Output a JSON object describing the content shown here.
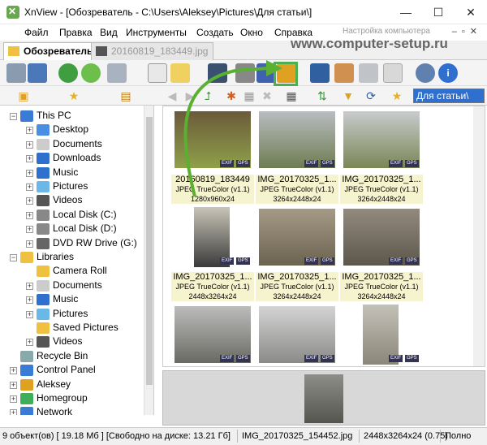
{
  "window": {
    "title": "XnView - [Обозреватель - C:\\Users\\Aleksey\\Pictures\\Для статьи\\]"
  },
  "menu": {
    "items": [
      "Файл",
      "Правка",
      "Вид",
      "Инструменты",
      "Создать",
      "Окно",
      "Справка"
    ]
  },
  "watermark": {
    "small": "Настройка компьютера",
    "site": "www.computer-setup.ru"
  },
  "tabs": [
    {
      "label": "Обозреватель",
      "active": true
    },
    {
      "label": "20160819_183449.jpg",
      "active": false
    }
  ],
  "toolbar2": {
    "folder_select": "Для статьи\\"
  },
  "tree": [
    {
      "label": "This PC",
      "icon": "computer-icon"
    },
    {
      "label": "Desktop",
      "icon": "desktop-icon"
    },
    {
      "label": "Documents",
      "icon": "documents-icon"
    },
    {
      "label": "Downloads",
      "icon": "downloads-icon"
    },
    {
      "label": "Music",
      "icon": "music-icon"
    },
    {
      "label": "Pictures",
      "icon": "pictures-icon"
    },
    {
      "label": "Videos",
      "icon": "videos-icon"
    },
    {
      "label": "Local Disk (C:)",
      "icon": "drive-icon"
    },
    {
      "label": "Local Disk (D:)",
      "icon": "drive-icon"
    },
    {
      "label": "DVD RW Drive (G:)",
      "icon": "dvd-icon"
    },
    {
      "label": "Libraries",
      "icon": "library-icon"
    },
    {
      "label": "Camera Roll",
      "icon": "folder-icon"
    },
    {
      "label": "Documents",
      "icon": "documents-icon"
    },
    {
      "label": "Music",
      "icon": "music-icon"
    },
    {
      "label": "Pictures",
      "icon": "pictures-icon"
    },
    {
      "label": "Saved Pictures",
      "icon": "folder-icon"
    },
    {
      "label": "Videos",
      "icon": "videos-icon"
    },
    {
      "label": "Recycle Bin",
      "icon": "recycle-bin-icon"
    },
    {
      "label": "Control Panel",
      "icon": "control-panel-icon"
    },
    {
      "label": "Aleksey",
      "icon": "user-icon"
    },
    {
      "label": "Homegroup",
      "icon": "homegroup-icon"
    },
    {
      "label": "Network",
      "icon": "network-icon"
    }
  ],
  "thumbnails": [
    {
      "name": "20160819_183449",
      "format": "JPEG TrueColor (v1.1)",
      "info": "1280x960x24",
      "colors": [
        "#6b5a3a",
        "#8fa04a"
      ]
    },
    {
      "name": "IMG_20170325_1...",
      "format": "JPEG TrueColor (v1.1)",
      "info": "3264x2448x24",
      "colors": [
        "#b9bcc0",
        "#6e7d52"
      ]
    },
    {
      "name": "IMG_20170325_1...",
      "format": "JPEG TrueColor (v1.1)",
      "info": "3264x2448x24",
      "colors": [
        "#c9ccce",
        "#7a8657"
      ]
    },
    {
      "name": "IMG_20170325_1...",
      "format": "JPEG TrueColor (v1.1)",
      "info": "2448x3264x24",
      "colors": [
        "#c8c4b7",
        "#3a3a3a"
      ]
    },
    {
      "name": "IMG_20170325_1...",
      "format": "JPEG TrueColor (v1.1)",
      "info": "3264x2448x24",
      "colors": [
        "#a59a86",
        "#6b6250"
      ]
    },
    {
      "name": "IMG_20170325_1...",
      "format": "JPEG TrueColor (v1.1)",
      "info": "3264x2448x24",
      "colors": [
        "#928a7d",
        "#5d574c"
      ]
    },
    {
      "name": "",
      "format": "",
      "info": "",
      "colors": [
        "#bcbcbc",
        "#6a6a64"
      ]
    },
    {
      "name": "",
      "format": "",
      "info": "",
      "colors": [
        "#d4d4d4",
        "#8a8a88"
      ]
    },
    {
      "name": "",
      "format": "",
      "info": "",
      "colors": [
        "#c3c0b8",
        "#8b8779"
      ]
    }
  ],
  "badges": {
    "exif": "EXIF",
    "gps": "GPS"
  },
  "status": {
    "count": "9 объект(ов) [ 19.18 Мб ] [Свободно на диске: 13.21 Гб]",
    "file": "IMG_20170325_154452.jpg",
    "dims": "2448x3264x24 (0.75)",
    "zoom": "Полно"
  },
  "colors": {
    "highlight": "#4caf50",
    "selection": "#2f6fce"
  }
}
